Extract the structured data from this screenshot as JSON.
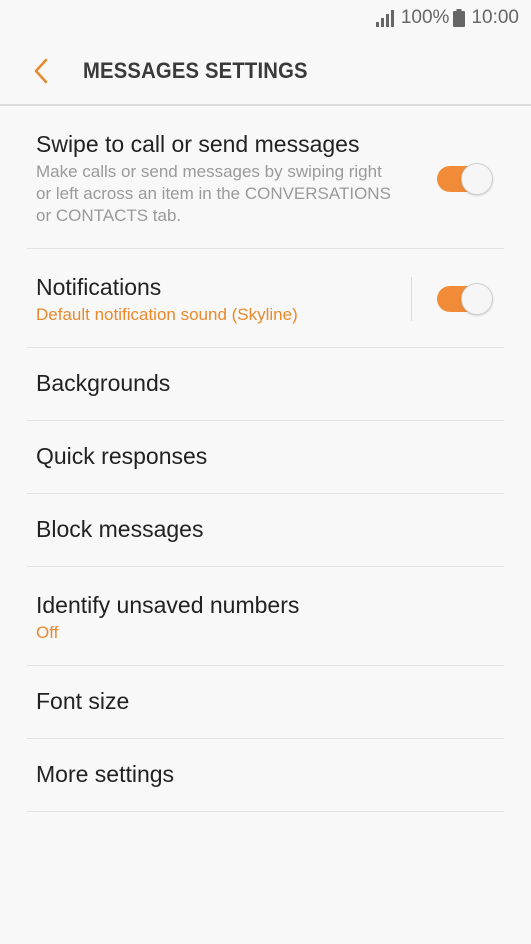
{
  "status_bar": {
    "battery_percent": "100%",
    "time": "10:00",
    "icons": [
      "signal-icon",
      "battery-icon"
    ]
  },
  "header": {
    "title": "MESSAGES SETTINGS",
    "back_icon": "chevron-left-icon"
  },
  "colors": {
    "accent": "#f28b37",
    "accent_text": "#e8892c",
    "background": "#f8f8f8"
  },
  "settings": {
    "swipe": {
      "title": "Swipe to call or send messages",
      "description": "Make calls or send messages by swiping right or left across an item in the CONVERSATIONS or CONTACTS tab.",
      "enabled": true
    },
    "notifications": {
      "title": "Notifications",
      "subtitle": "Default notification sound (Skyline)",
      "enabled": true
    },
    "backgrounds": {
      "title": "Backgrounds"
    },
    "quick_responses": {
      "title": "Quick responses"
    },
    "block_messages": {
      "title": "Block messages"
    },
    "identify_unsaved": {
      "title": "Identify unsaved numbers",
      "subtitle": "Off"
    },
    "font_size": {
      "title": "Font size"
    },
    "more_settings": {
      "title": "More settings"
    }
  }
}
